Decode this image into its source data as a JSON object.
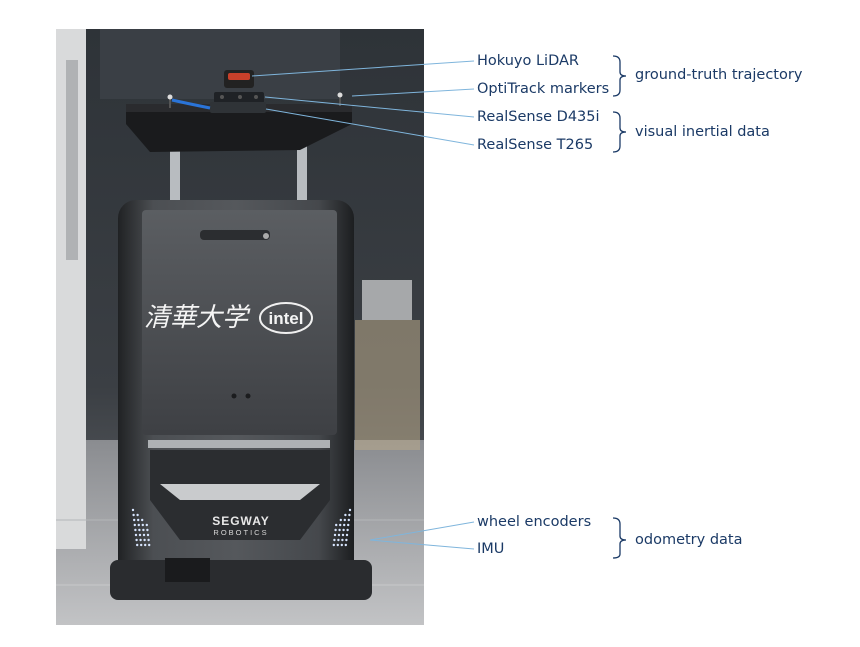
{
  "labels": {
    "hokuyo": "Hokuyo LiDAR",
    "optitrack": "OptiTrack markers",
    "d435i": "RealSense D435i",
    "t265": "RealSense T265",
    "wheel_encoders": "wheel encoders",
    "imu": "IMU"
  },
  "groups": {
    "ground_truth": "ground-truth trajectory",
    "visual_inertial": "visual inertial data",
    "odometry": "odometry data"
  },
  "robot_text": {
    "university_logo": "清華大学",
    "intel_logo": "intel",
    "brand_line1": "SEGWAY",
    "brand_line2": "ROBOTICS"
  },
  "colors": {
    "label_text": "#1b3a66",
    "leader_line": "#7fb5dc",
    "bracket": "#1b3a66"
  }
}
